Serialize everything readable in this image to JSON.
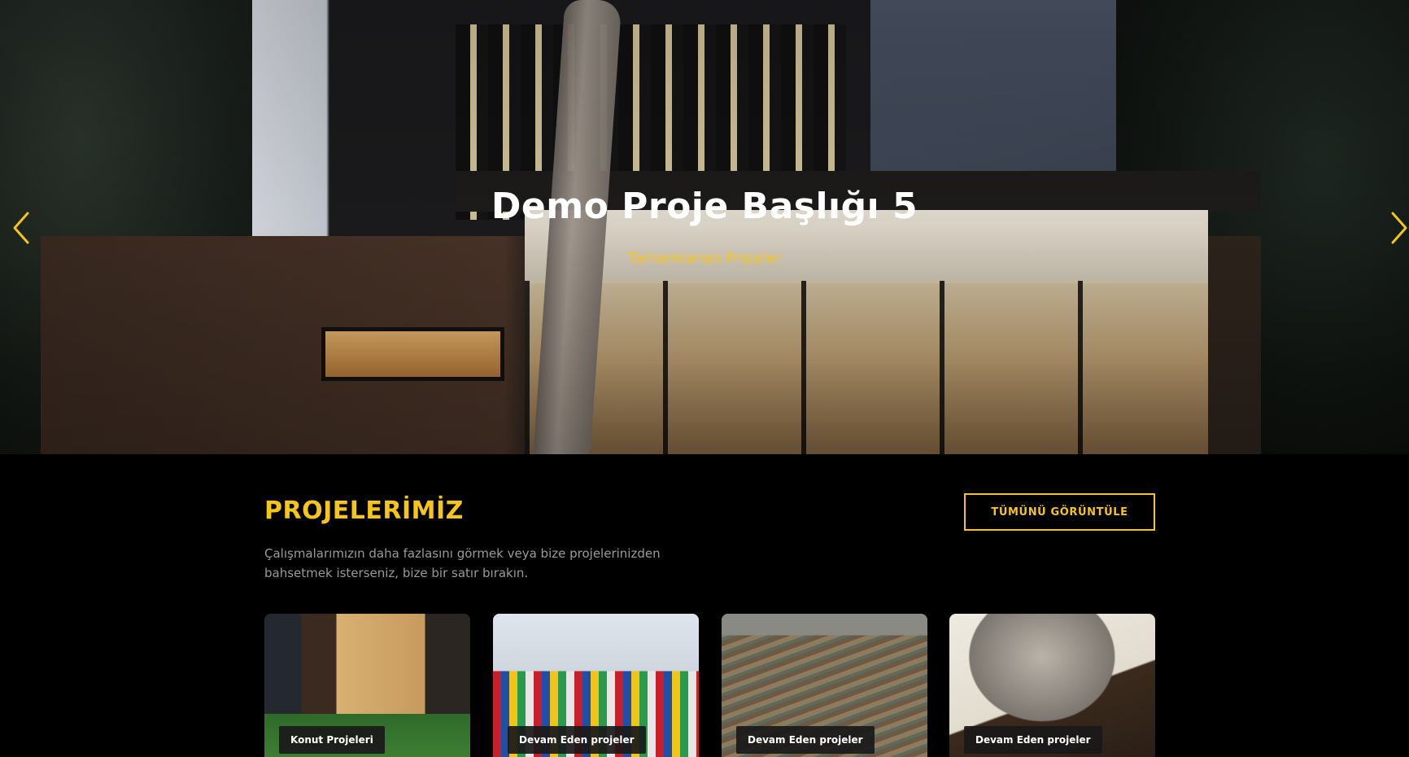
{
  "hero": {
    "title": "Demo Proje Başlığı 5",
    "subtitle": "Tamamlanan Projeler",
    "prev_icon": "chevron-left-icon",
    "next_icon": "chevron-right-icon",
    "accent_color": "#f5c518"
  },
  "projects": {
    "title": "PROJELERİMİZ",
    "view_all_label": "TÜMÜNÜ GÖRÜNTÜLE",
    "description": "Çalışmalarımızın daha fazlasını görmek veya bize projelerinizden bahsetmek isterseniz, bize bir satır bırakın.",
    "cards": [
      {
        "label": "Konut Projeleri"
      },
      {
        "label": "Devam Eden projeler"
      },
      {
        "label": "Devam Eden projeler"
      },
      {
        "label": "Devam Eden projeler"
      }
    ]
  }
}
